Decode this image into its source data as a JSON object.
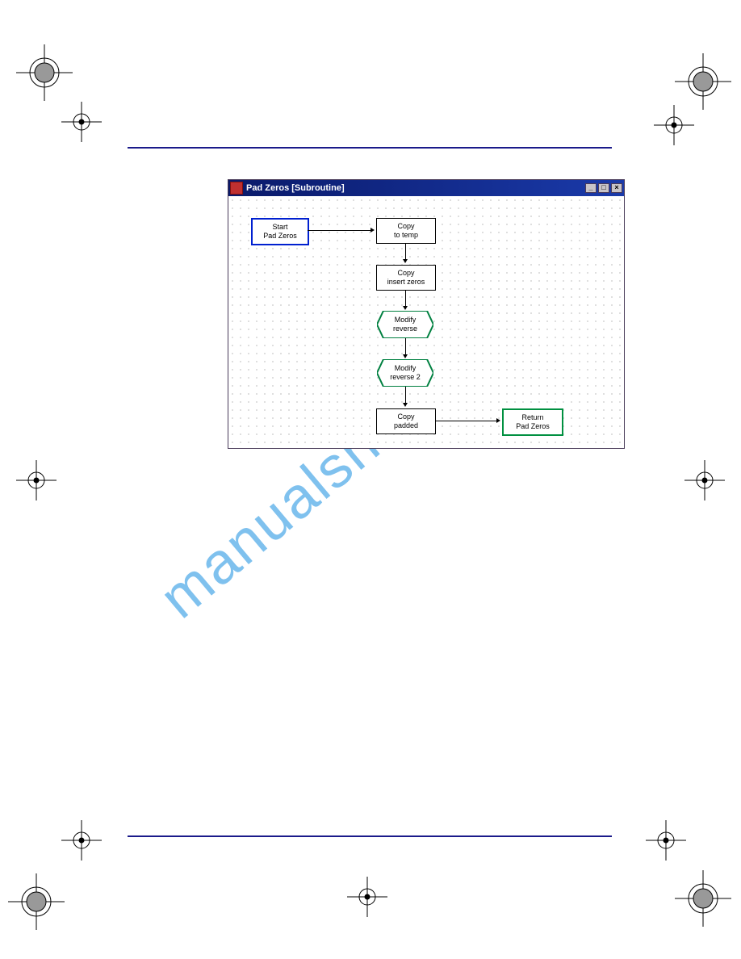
{
  "window": {
    "title": "Pad Zeros [Subroutine]"
  },
  "nodes": {
    "start": {
      "l1": "Start",
      "l2": "Pad Zeros"
    },
    "copy1": {
      "l1": "Copy",
      "l2": "to temp"
    },
    "copy2": {
      "l1": "Copy",
      "l2": "insert zeros"
    },
    "mod1": {
      "l1": "Modify",
      "l2": "reverse"
    },
    "mod2": {
      "l1": "Modify",
      "l2": "reverse 2"
    },
    "copy3": {
      "l1": "Copy",
      "l2": "padded"
    },
    "ret": {
      "l1": "Return",
      "l2": "Pad Zeros"
    }
  },
  "watermark": "manualshive.com"
}
